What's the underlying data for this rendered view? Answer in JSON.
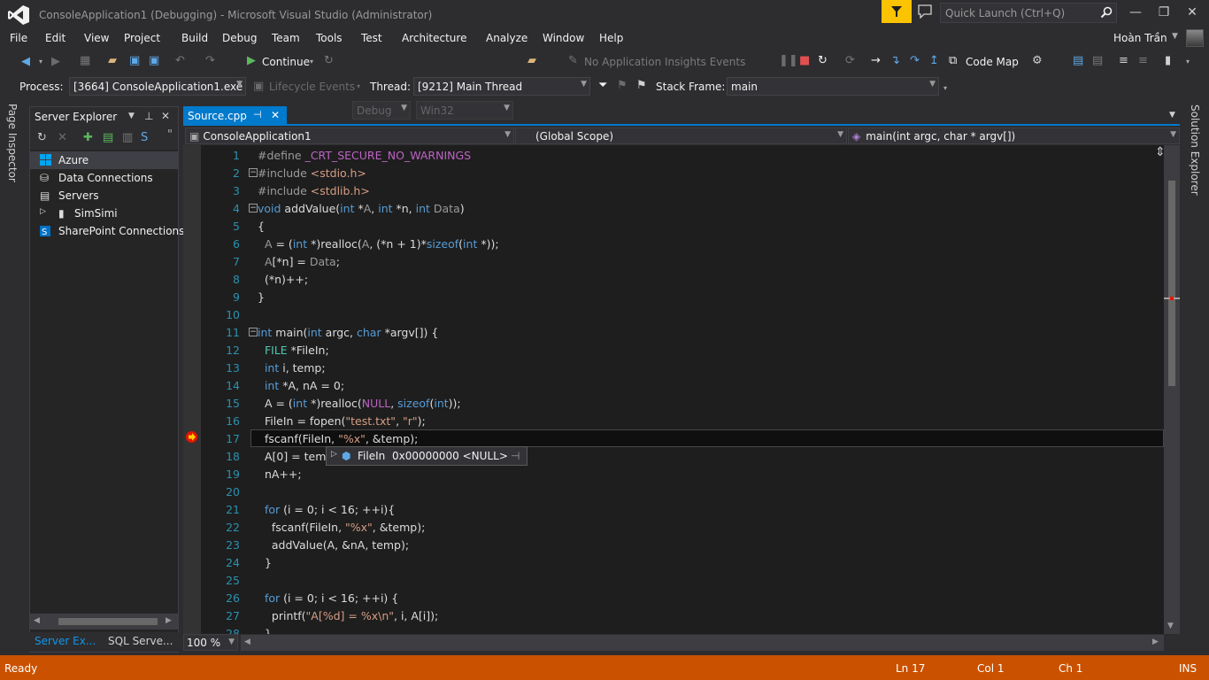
{
  "window": {
    "title": "ConsoleApplication1 (Debugging) - Microsoft Visual Studio (Administrator)",
    "quick_launch_placeholder": "Quick Launch (Ctrl+Q)",
    "minimize": "—",
    "restore": "❐",
    "close": "✕"
  },
  "menu": [
    "File",
    "Edit",
    "View",
    "Project",
    "Build",
    "Debug",
    "Team",
    "Tools",
    "Test",
    "Architecture",
    "Analyze",
    "Window",
    "Help"
  ],
  "user": {
    "name": "Hoàn Trần"
  },
  "toolbar1": {
    "continue_label": "Continue",
    "config": "Debug",
    "platform": "Win32",
    "insights_label": "No Application Insights Events",
    "code_map_label": "Code Map"
  },
  "toolbar2": {
    "process_label": "Process:",
    "process_value": "[3664] ConsoleApplication1.exe",
    "lifecycle_label": "Lifecycle Events",
    "thread_label": "Thread:",
    "thread_value": "[9212] Main Thread",
    "stack_label": "Stack Frame:",
    "stack_value": "main"
  },
  "side_tabs": {
    "left": "Page Inspector",
    "right": "Solution Explorer"
  },
  "server_explorer": {
    "title": "Server Explorer",
    "items": [
      {
        "label": "Azure",
        "icon": "windows-azure-icon"
      },
      {
        "label": "Data Connections",
        "icon": "data-connections-icon"
      },
      {
        "label": "Servers",
        "icon": "servers-icon"
      },
      {
        "label": "SimSimi",
        "icon": "computer-icon"
      },
      {
        "label": "SharePoint Connections",
        "icon": "sharepoint-icon"
      }
    ],
    "tabs": [
      "Server Ex...",
      "SQL Serve..."
    ]
  },
  "editor": {
    "tab": "Source.cpp",
    "nav_project": "ConsoleApplication1",
    "nav_scope": "(Global Scope)",
    "nav_member": "main(int argc, char * argv[])",
    "zoom": "100 %",
    "current_line": 17,
    "lines": [
      {
        "n": "1",
        "text": "#define _CRT_SECURE_NO_WARNINGS"
      },
      {
        "n": "2",
        "text": "#include <stdio.h>"
      },
      {
        "n": "3",
        "text": "#include <stdlib.h>"
      },
      {
        "n": "4",
        "text": "void addValue(int *A, int *n, int Data)"
      },
      {
        "n": "5",
        "text": "{"
      },
      {
        "n": "6",
        "text": "  A = (int *)realloc(A, (*n + 1)*sizeof(int *));"
      },
      {
        "n": "7",
        "text": "  A[*n] = Data;"
      },
      {
        "n": "8",
        "text": "  (*n)++;"
      },
      {
        "n": "9",
        "text": "}"
      },
      {
        "n": "10",
        "text": ""
      },
      {
        "n": "11",
        "text": "int main(int argc, char *argv[]) {"
      },
      {
        "n": "12",
        "text": "  FILE *FileIn;"
      },
      {
        "n": "13",
        "text": "  int i, temp;"
      },
      {
        "n": "14",
        "text": "  int *A, nA = 0;"
      },
      {
        "n": "15",
        "text": "  A = (int *)realloc(NULL, sizeof(int));"
      },
      {
        "n": "16",
        "text": "  FileIn = fopen(\"test.txt\", \"r\");"
      },
      {
        "n": "17",
        "text": "  fscanf(FileIn, \"%x\", &temp);"
      },
      {
        "n": "18",
        "text": "  A[0] = tem"
      },
      {
        "n": "19",
        "text": "  nA++;"
      },
      {
        "n": "20",
        "text": ""
      },
      {
        "n": "21",
        "text": "  for (i = 0; i < 16; ++i){"
      },
      {
        "n": "22",
        "text": "    fscanf(FileIn, \"%x\", &temp);"
      },
      {
        "n": "23",
        "text": "    addValue(A, &nA, temp);"
      },
      {
        "n": "24",
        "text": "  }"
      },
      {
        "n": "25",
        "text": ""
      },
      {
        "n": "26",
        "text": "  for (i = 0; i < 16; ++i) {"
      },
      {
        "n": "27",
        "text": "    printf(\"A[%d] = %x\\n\", i, A[i]);"
      },
      {
        "n": "28",
        "text": "  }"
      }
    ],
    "datatip": {
      "name": "FileIn",
      "value": "0x00000000 <NULL>"
    }
  },
  "status": {
    "ready": "Ready",
    "ln": "Ln 17",
    "col": "Col 1",
    "ch": "Ch 1",
    "mode": "INS"
  },
  "colors": {
    "accent": "#007acc",
    "status": "#ca5100",
    "flag": "#fcc300",
    "bg": "#2d2d30",
    "editor_bg": "#1e1e1e"
  }
}
